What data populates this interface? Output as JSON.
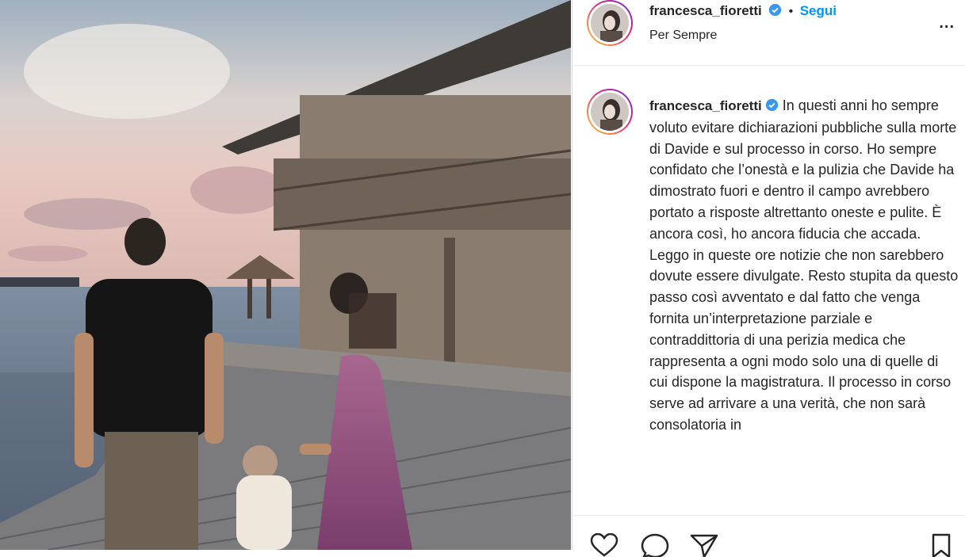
{
  "post": {
    "username": "francesca_fioretti",
    "follow_label": "Segui",
    "separator": "•",
    "location": "Per Sempre",
    "more_label": "..."
  },
  "caption": {
    "username": "francesca_fioretti",
    "text": "In questi anni ho sempre voluto evitare dichiarazioni pubbliche sulla morte di Davide e sul processo in corso. Ho sempre confidato che l’onestà e la pulizia che Davide ha dimostrato fuori e dentro il campo avrebbero portato a risposte altrettanto oneste e pulite. È ancora così, ho ancora fiducia che accada. Leggo in queste ore notizie che non sarebbero dovute essere divulgate. Resto stupita da questo passo così avventato e dal fatto che venga fornita un’interpretazione parziale e contraddittoria di una perizia medica che rappresenta a ogni modo solo una di quelle di cui dispone la magistratura. Il processo in corso serve ad arrivare a una verità, che non sarà consolatoria in"
  },
  "icons": {
    "verified": "verified-badge-icon",
    "like": "heart-icon",
    "comment": "comment-icon",
    "share": "share-icon",
    "save": "bookmark-icon"
  },
  "colors": {
    "link": "#0095f6",
    "text": "#262626",
    "border": "#dbdbdb"
  }
}
